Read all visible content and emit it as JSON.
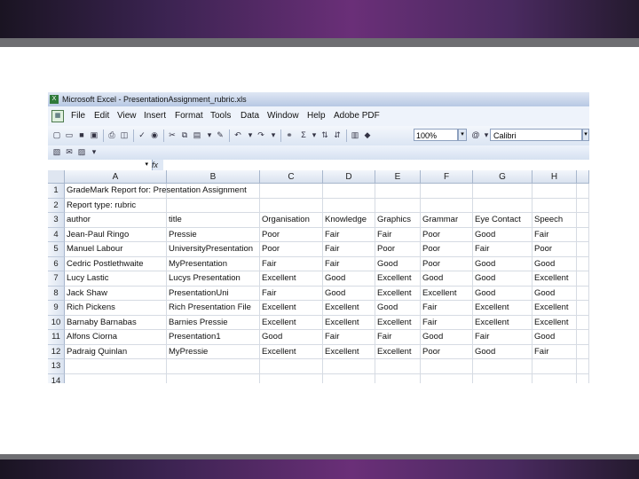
{
  "window": {
    "title": "Microsoft Excel - PresentationAssignment_rubric.xls"
  },
  "menu": [
    "File",
    "Edit",
    "View",
    "Insert",
    "Format",
    "Tools",
    "Data",
    "Window",
    "Help",
    "Adobe PDF"
  ],
  "toolbar": {
    "zoom": "100%",
    "font": "Calibri",
    "sum_symbol": "Σ",
    "help_symbol": "@"
  },
  "formula_bar": {
    "fx": "fx",
    "name_box": ""
  },
  "columns": [
    "A",
    "B",
    "C",
    "D",
    "E",
    "F",
    "G",
    "H"
  ],
  "rows": [
    {
      "n": "1",
      "cells": [
        "GradeMark Report for: Presentation Assignment",
        "",
        "",
        "",
        "",
        "",
        "",
        ""
      ]
    },
    {
      "n": "2",
      "cells": [
        "Report type: rubric",
        "",
        "",
        "",
        "",
        "",
        "",
        ""
      ]
    },
    {
      "n": "3",
      "cells": [
        "author",
        "title",
        "Organisation",
        "Knowledge",
        "Graphics",
        "Grammar",
        "Eye Contact",
        "Speech"
      ]
    },
    {
      "n": "4",
      "cells": [
        "Jean-Paul Ringo",
        "Pressie",
        "Poor",
        "Fair",
        "Fair",
        "Poor",
        "Good",
        "Fair"
      ]
    },
    {
      "n": "5",
      "cells": [
        "Manuel Labour",
        "UniversityPresentation",
        "Poor",
        "Fair",
        "Poor",
        "Poor",
        "Fair",
        "Poor"
      ]
    },
    {
      "n": "6",
      "cells": [
        "Cedric Postlethwaite",
        "MyPresentation",
        "Fair",
        "Fair",
        "Good",
        "Poor",
        "Good",
        "Good"
      ]
    },
    {
      "n": "7",
      "cells": [
        "Lucy Lastic",
        "Lucys Presentation",
        "Excellent",
        "Good",
        "Excellent",
        "Good",
        "Good",
        "Excellent"
      ]
    },
    {
      "n": "8",
      "cells": [
        "Jack Shaw",
        "PresentationUni",
        "Fair",
        "Good",
        "Excellent",
        "Excellent",
        "Good",
        "Good"
      ]
    },
    {
      "n": "9",
      "cells": [
        "Rich Pickens",
        "Rich Presentation File",
        "Excellent",
        "Excellent",
        "Good",
        "Fair",
        "Excellent",
        "Excellent"
      ]
    },
    {
      "n": "10",
      "cells": [
        "Barnaby Barnabas",
        "Barnies Pressie",
        "Excellent",
        "Excellent",
        "Excellent",
        "Fair",
        "Excellent",
        "Excellent"
      ]
    },
    {
      "n": "11",
      "cells": [
        "Alfons Ciorna",
        "Presentation1",
        "Good",
        "Fair",
        "Fair",
        "Good",
        "Fair",
        "Good"
      ]
    },
    {
      "n": "12",
      "cells": [
        "Padraig Quinlan",
        "MyPressie",
        "Excellent",
        "Excellent",
        "Excellent",
        "Poor",
        "Good",
        "Fair"
      ]
    },
    {
      "n": "13",
      "cells": [
        "",
        "",
        "",
        "",
        "",
        "",
        "",
        ""
      ]
    },
    {
      "n": "14",
      "cells": [
        "",
        "",
        "",
        "",
        "",
        "",
        "",
        ""
      ]
    }
  ]
}
